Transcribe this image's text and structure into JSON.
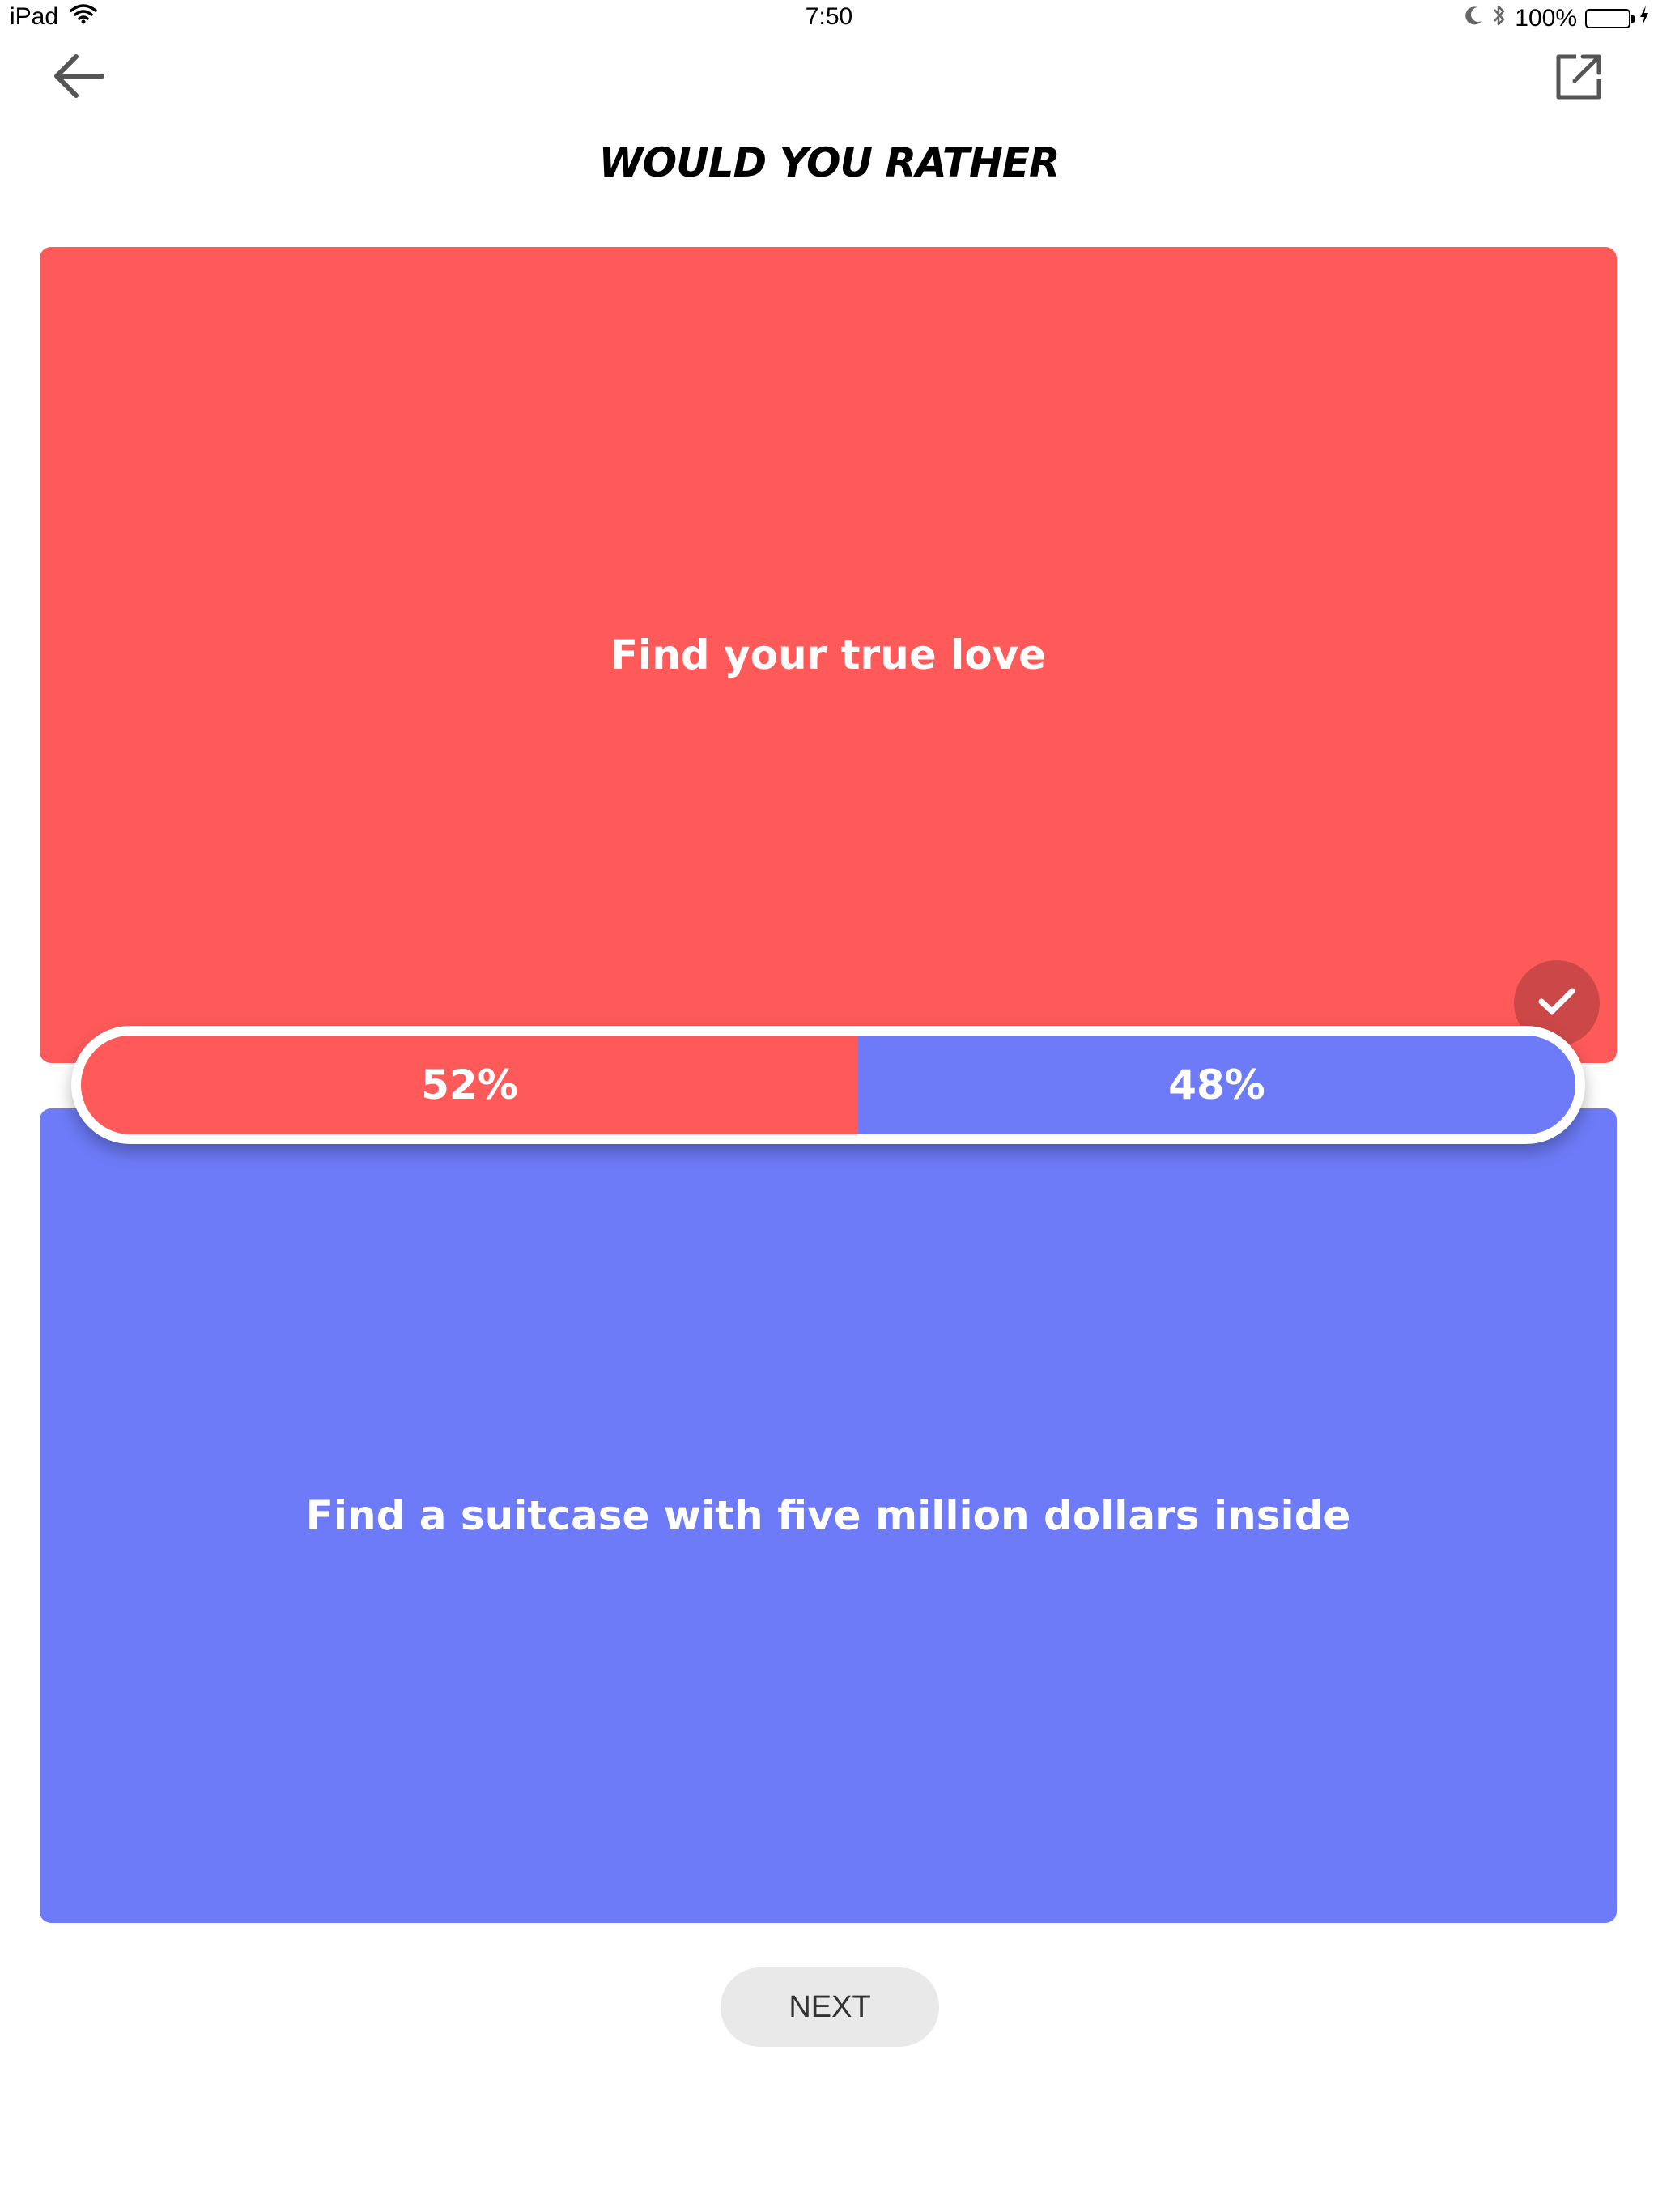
{
  "status_bar": {
    "device": "iPad",
    "time": "7:50",
    "battery_percent": "100%",
    "battery_level": 1.0,
    "icons": [
      "wifi-icon",
      "moon-icon",
      "bluetooth-icon",
      "battery-icon",
      "charging-icon"
    ]
  },
  "header": {
    "title": "WOULD YOU RATHER",
    "back_icon": "arrow-left-icon",
    "share_icon": "share-icon"
  },
  "options": {
    "a": {
      "text": "Find your true love",
      "percent_label": "52%",
      "percent": 52,
      "color": "#fe5a5a",
      "selected": true
    },
    "b": {
      "text": "Find a suitcase with five million dollars inside",
      "percent_label": "48%",
      "percent": 48,
      "color": "#6d7bf8",
      "selected": false
    }
  },
  "selection_icon": "checkmark-icon",
  "actions": {
    "next_label": "NEXT"
  }
}
